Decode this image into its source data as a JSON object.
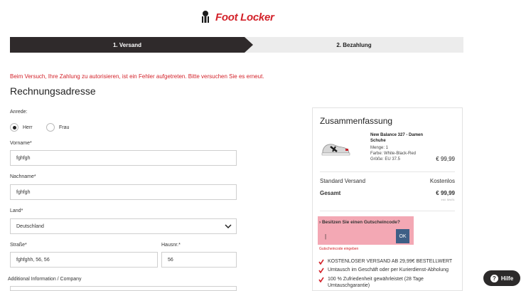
{
  "brand": {
    "name": "Foot Locker",
    "accent": "#d3222a",
    "icon": "referee-logo-icon"
  },
  "steps": [
    {
      "label": "1. Versand",
      "active": true
    },
    {
      "label": "2. Bezahlung",
      "active": false
    }
  ],
  "error_message": "Beim Versuch, Ihre Zahlung zu autorisieren, ist ein Fehler aufgetreten. Bitte versuchen Sie es erneut.",
  "form": {
    "title": "Rechnungsadresse",
    "salutation": {
      "label": "Anrede:",
      "options": [
        {
          "label": "Herr",
          "selected": true
        },
        {
          "label": "Frau",
          "selected": false
        }
      ]
    },
    "first_name": {
      "label": "Vorname*",
      "value": "fghfgh"
    },
    "last_name": {
      "label": "Nachname*",
      "value": "fghfgh"
    },
    "country": {
      "label": "Land*",
      "value": "Deutschland"
    },
    "street": {
      "label": "Straße*",
      "value": "fghfghh, 56, 56"
    },
    "house_number": {
      "label": "Hausnr.*",
      "value": "56"
    },
    "additional": {
      "label": "Additional Information / Company",
      "value": ""
    }
  },
  "summary": {
    "title": "Zusammenfassung",
    "product": {
      "name": "New Balance 327 - Damen Schuhe",
      "quantity": "Menge: 1",
      "color": "Farbe: White-Black-Red",
      "size": "Größe: EU 37.5",
      "price": "€ 99,99",
      "image_icon": "sneaker-icon"
    },
    "shipping": {
      "label": "Standard Versand",
      "value": "Kostenlos"
    },
    "total": {
      "label": "Gesamt",
      "value": "€ 99,99",
      "note": "inkl. MwSt."
    },
    "coupon": {
      "question": "Besitzen Sie einen Gutscheincode?",
      "input_value": "|",
      "button": "OK",
      "link": "Gutscheincode eingeben"
    },
    "benefits": [
      "KOSTENLOSER VERSAND AB 29,99€ BESTELLWERT",
      "Umtausch im Geschäft oder per Kurierdienst-Abholung",
      "100 % Zufriedenheit gewährleistet (28 Tage Umtauschgarantie)"
    ]
  },
  "help": {
    "label": "Hilfe",
    "icon": "question-icon"
  }
}
